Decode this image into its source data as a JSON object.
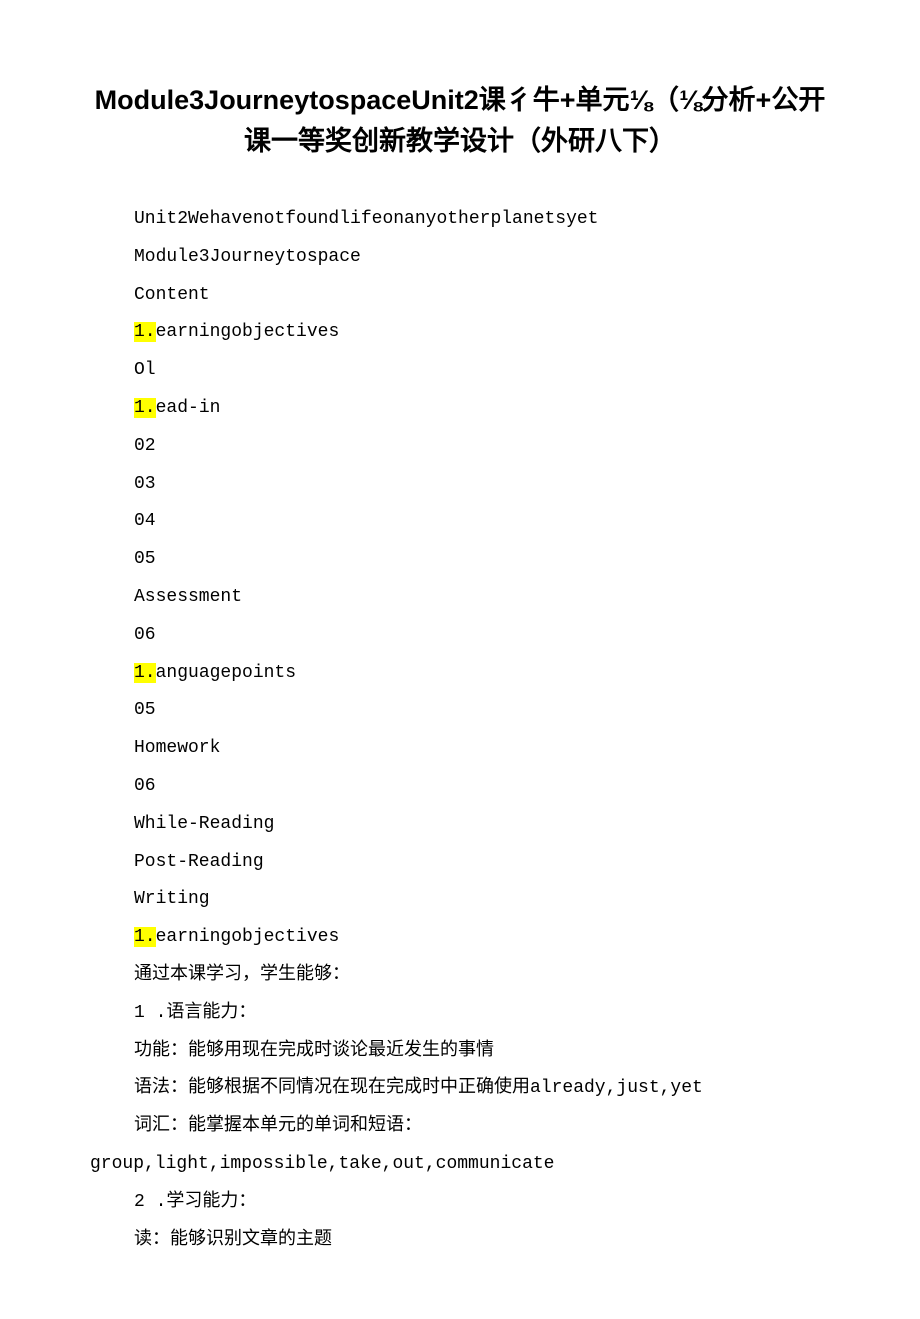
{
  "title": "Module3JourneytospaceUnit2课彳牛+单元⅛（⅛分析+公开课一等奖创新教学设计（外研八下）",
  "lines": [
    {
      "text": "Unit2Wehavenotfoundlifeonanyotherplanetsyet",
      "indent": true
    },
    {
      "text": "Module3Journeytospace",
      "indent": true
    },
    {
      "text": "Content",
      "indent": true
    },
    {
      "prefix": "1.",
      "text": "earningobjectives",
      "highlight": true,
      "indent": true
    },
    {
      "text": "Ol",
      "indent": true
    },
    {
      "prefix": "1.",
      "text": "ead-in",
      "highlight": true,
      "indent": true
    },
    {
      "text": "02",
      "indent": true
    },
    {
      "text": "03",
      "indent": true
    },
    {
      "text": "04",
      "indent": true
    },
    {
      "text": "05",
      "indent": true
    },
    {
      "text": "Assessment",
      "indent": true
    },
    {
      "text": "06",
      "indent": true
    },
    {
      "prefix": "1.",
      "text": "anguagepoints",
      "highlight": true,
      "indent": true
    },
    {
      "text": "05",
      "indent": true
    },
    {
      "text": "Homework",
      "indent": true
    },
    {
      "text": "06",
      "indent": true
    },
    {
      "text": "While-Reading",
      "indent": true
    },
    {
      "text": "Post-Reading",
      "indent": true
    },
    {
      "text": "Writing",
      "indent": true
    },
    {
      "prefix": "1.",
      "text": "earningobjectives",
      "highlight": true,
      "indent": true
    },
    {
      "text": "通过本课学习，学生能够：",
      "indent": true
    },
    {
      "text": "1 .语言能力：",
      "indent": true
    },
    {
      "text": "功能：能够用现在完成时谈论最近发生的事情",
      "indent": true
    },
    {
      "text": "语法：能够根据不同情况在现在完成时中正确使用already,just,yet",
      "indent": true
    },
    {
      "text": "词汇：能掌握本单元的单词和短语：",
      "indent": true
    },
    {
      "text": "group,light,impossible,take,out,communicate",
      "indent": false
    },
    {
      "text": "2 .学习能力：",
      "indent": true
    },
    {
      "text": "读：能够识别文章的主题",
      "indent": true
    }
  ]
}
